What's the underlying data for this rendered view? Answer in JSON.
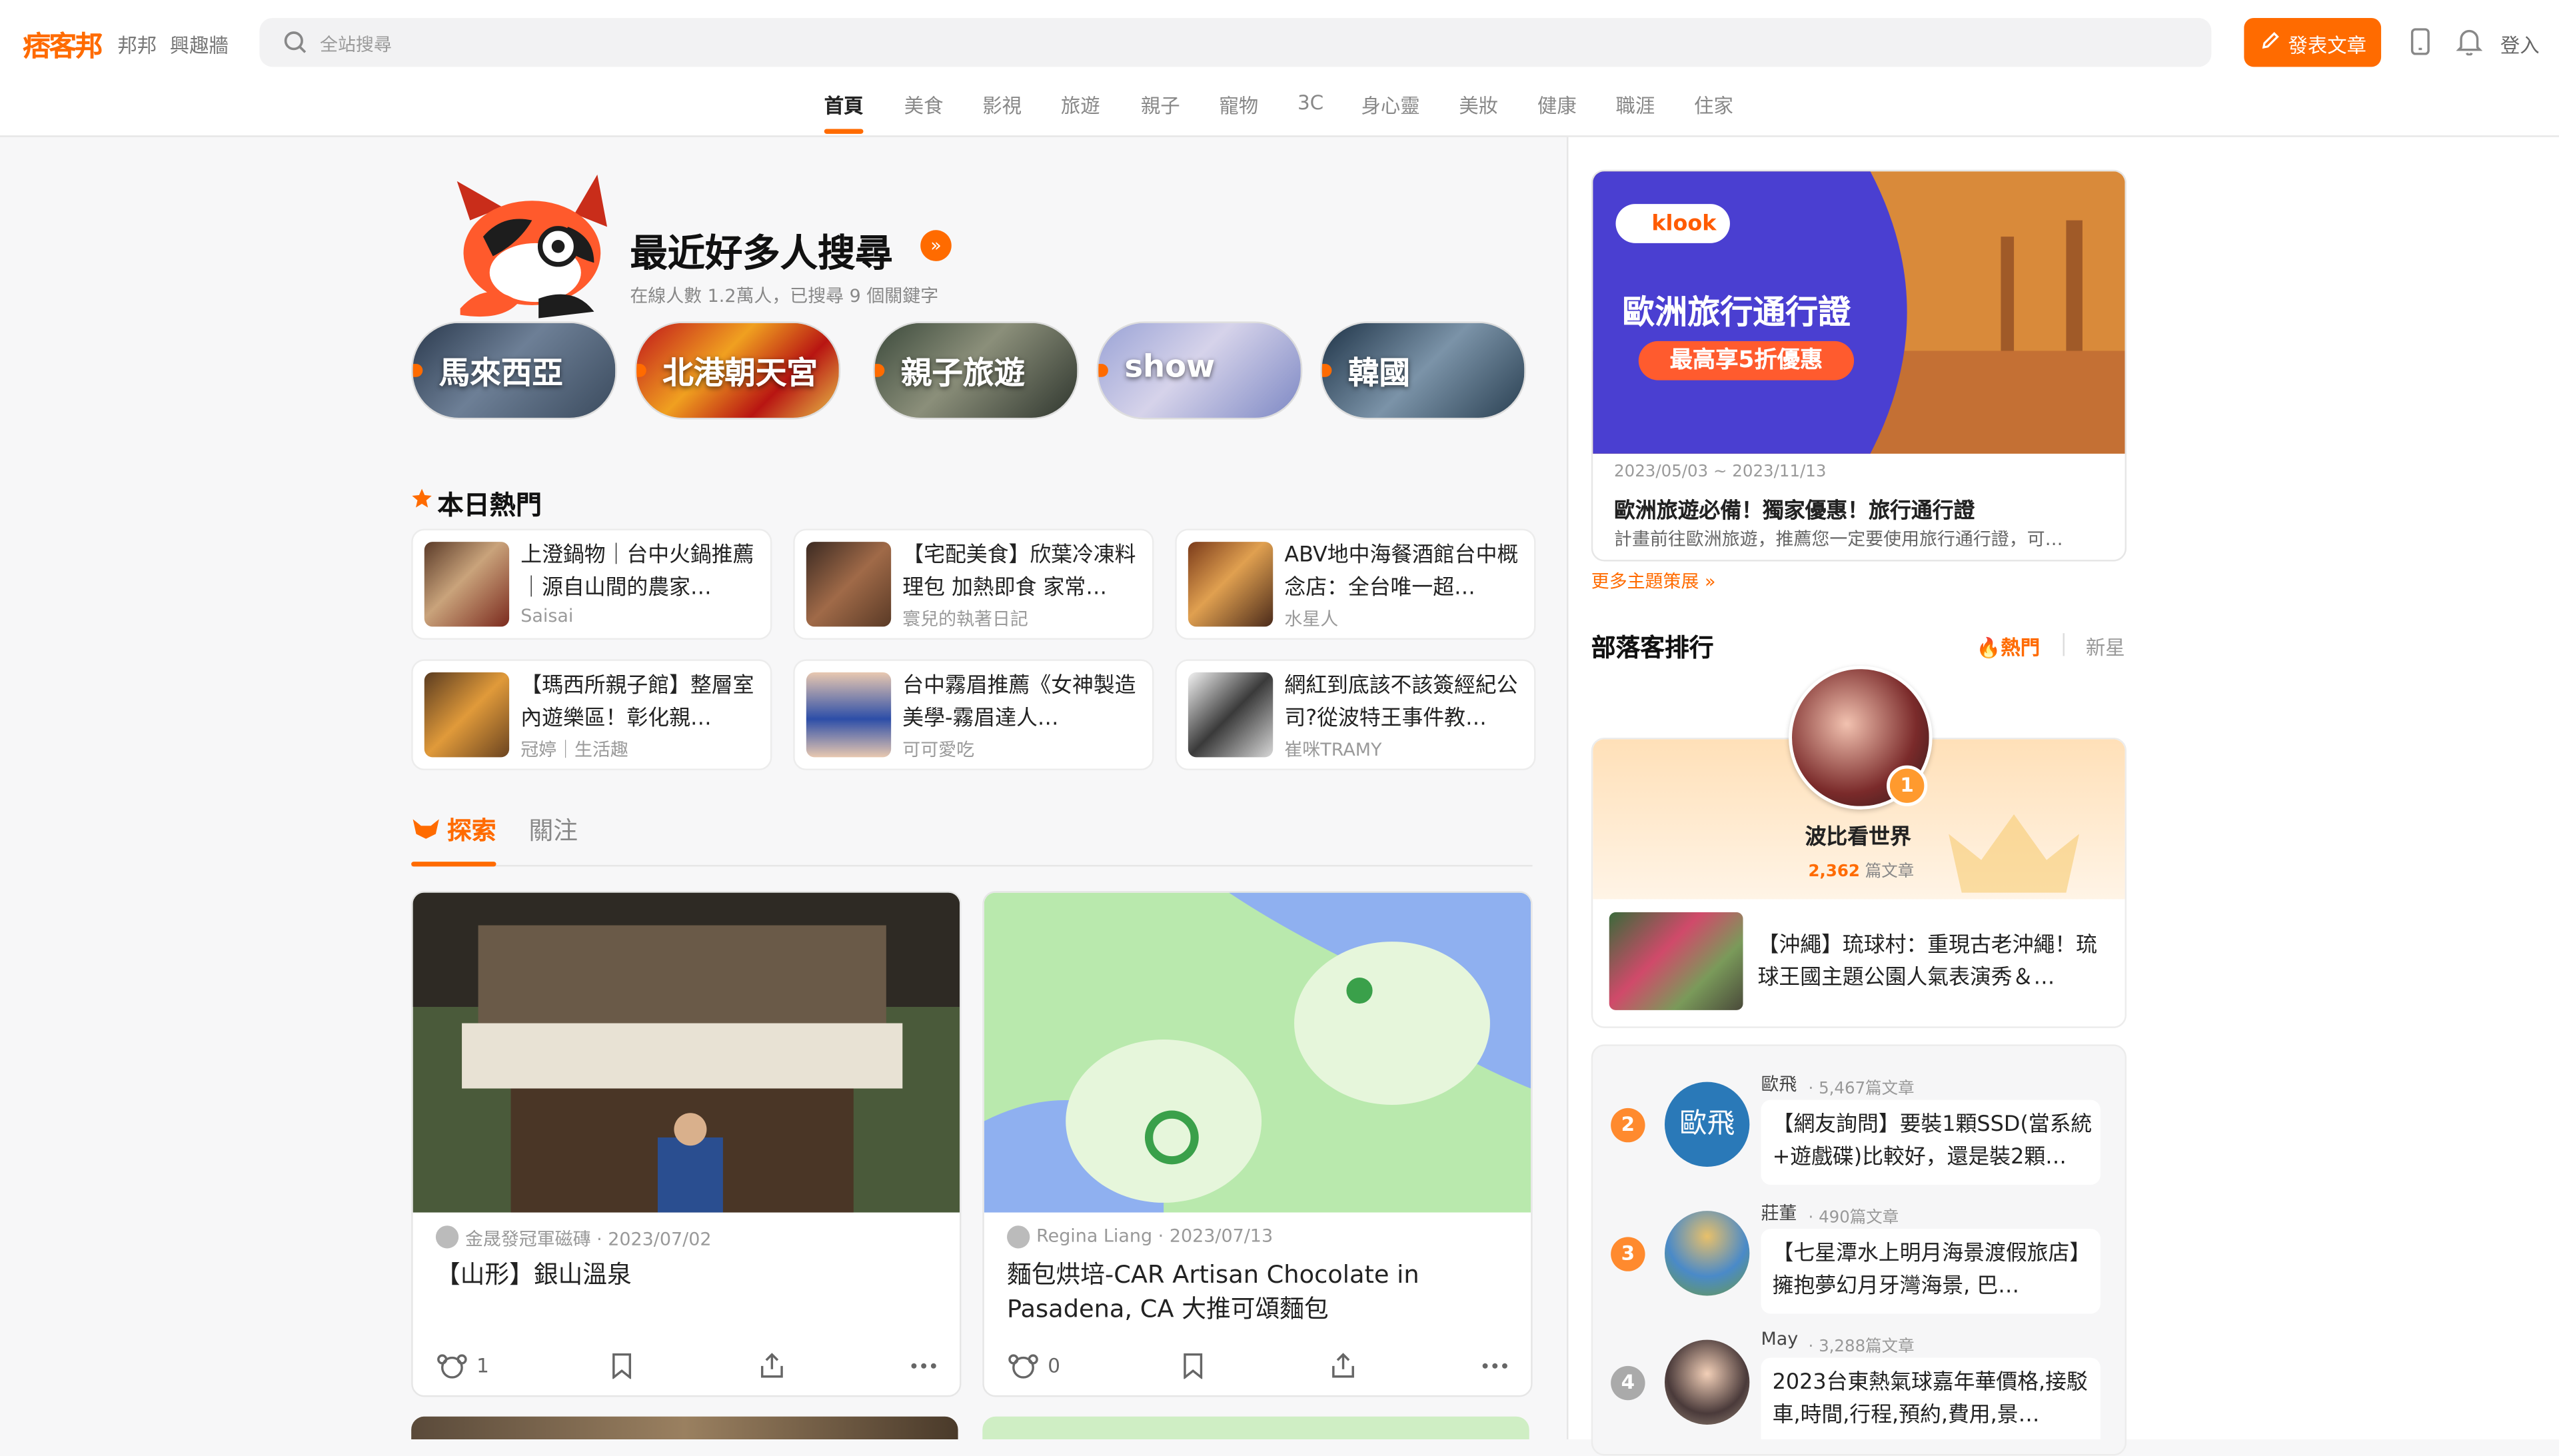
{
  "header": {
    "logo": "痞客邦",
    "links": [
      "邦邦",
      "興趣牆"
    ],
    "search_placeholder": "全站搜尋",
    "post_button": "發表文章",
    "login": "登入"
  },
  "categories": [
    "首頁",
    "美食",
    "影視",
    "旅遊",
    "親子",
    "寵物",
    "3C",
    "身心靈",
    "美妝",
    "健康",
    "職涯",
    "住家"
  ],
  "hero": {
    "title": "最近好多人搜尋",
    "subtitle": "在線人數 1.2萬人，已搜尋 9 個關鍵字",
    "keywords": [
      "馬來西亞",
      "北港朝天宮",
      "親子旅遊",
      "show",
      "韓國"
    ]
  },
  "hot_today": {
    "title": "本日熱門",
    "items": [
      {
        "title": "上澄鍋物｜台中火鍋推薦｜源自山間的農家…",
        "author": "Saisai"
      },
      {
        "title": "【宅配美食】欣葉冷凍料理包 加熱即食 家常…",
        "author": "寰兒的執著日記"
      },
      {
        "title": "ABV地中海餐酒館台中概念店：全台唯一超…",
        "author": "水星人"
      },
      {
        "title": "【瑪西所親子館】整層室內遊樂區！彰化親…",
        "author": "冠婷｜生活趣"
      },
      {
        "title": "台中霧眉推薦《女神製造美學-霧眉達人…",
        "author": "可可愛吃"
      },
      {
        "title": "網紅到底該不該簽經紀公司?從波特王事件教…",
        "author": "崔咪TRAMY"
      }
    ]
  },
  "feed_tabs": [
    "探索",
    "關注"
  ],
  "feed": [
    {
      "author": "金晟發冠軍磁磚",
      "date": "2023/07/02",
      "title": "【山形】銀山溫泉",
      "likes": "1"
    },
    {
      "author": "Regina Liang",
      "date": "2023/07/13",
      "title": "麵包烘培-CAR Artisan Chocolate in Pasadena, CA 大推可頌麵包",
      "likes": "0"
    }
  ],
  "ad": {
    "brand": "klook",
    "banner_title": "歐洲旅行通行證",
    "banner_badge": "最高享5折優惠",
    "dates": "2023/05/03 ~ 2023/11/13",
    "title": "歐洲旅遊必備！獨家優惠！旅行通行證",
    "desc": "計畫前往歐洲旅遊，推薦您一定要使用旅行通行證，可…",
    "more": "更多主題策展"
  },
  "ranking": {
    "title": "部落客排行",
    "tab_hot": "熱門",
    "tab_new": "新星",
    "top": {
      "rank": "1",
      "name": "波比看世界",
      "count": "2,362",
      "unit": "篇文章",
      "post": "【沖繩】琉球村：重現古老沖繩！琉球王國主題公園人氣表演秀＆…"
    },
    "list": [
      {
        "rank": "2",
        "name": "歐飛",
        "count": "5,467篇文章",
        "avatar_text": "歐飛",
        "post": "【網友詢問】要裝1顆SSD(當系統+遊戲碟)比較好，還是裝2顆…"
      },
      {
        "rank": "3",
        "name": "莊董",
        "count": "490篇文章",
        "post": "【七星潭水上明月海景渡假旅店】擁抱夢幻月牙灣海景, 巴…"
      },
      {
        "rank": "4",
        "name": "May",
        "count": "3,288篇文章",
        "post": "2023台東熱氣球嘉年華價格,接駁車,時間,行程,預約,費用,景…"
      }
    ]
  },
  "colors": {
    "accent": "#ff6b00",
    "ad_purple": "#4a3fd1"
  }
}
